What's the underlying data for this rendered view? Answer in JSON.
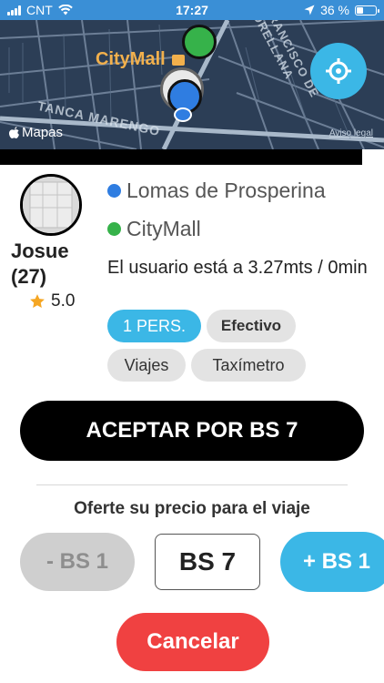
{
  "status_bar": {
    "carrier": "CNT",
    "time": "17:27",
    "battery": "36 %",
    "battery_level": 0.36,
    "icons": [
      "signal-icon",
      "wifi-icon",
      "location-arrow-icon",
      "battery-icon"
    ]
  },
  "map": {
    "poi_label": "CityMall",
    "street_labels": [
      "TANCA MARENGO",
      "FRANCISCO DE ORELLANA"
    ],
    "attribution": "Mapas",
    "legal": "Aviso legal",
    "colors": {
      "background": "#2c3e56",
      "pin_origin": "#2f7de1",
      "pin_destination": "#36b24a",
      "locate_button": "#3bb7e6"
    }
  },
  "passenger": {
    "name": "Josue",
    "trips": "(27)",
    "rating": "5.0"
  },
  "trip": {
    "origin": "Lomas de Prosperina",
    "destination": "CityMall",
    "distance_text": "El usuario está a 3.27mts / 0min",
    "origin_color": "#2f7de1",
    "destination_color": "#36b24a"
  },
  "chips": {
    "persons": "1 PERS.",
    "payment": "Efectivo",
    "trips": "Viajes",
    "meter": "Taxímetro"
  },
  "actions": {
    "accept_label": "ACEPTAR POR BS 7",
    "offer_title": "Oferte su precio para el viaje",
    "decrease_label": "- BS 1",
    "price_value": "BS 7",
    "increase_label": "+ BS 1",
    "cancel_label": "Cancelar"
  }
}
